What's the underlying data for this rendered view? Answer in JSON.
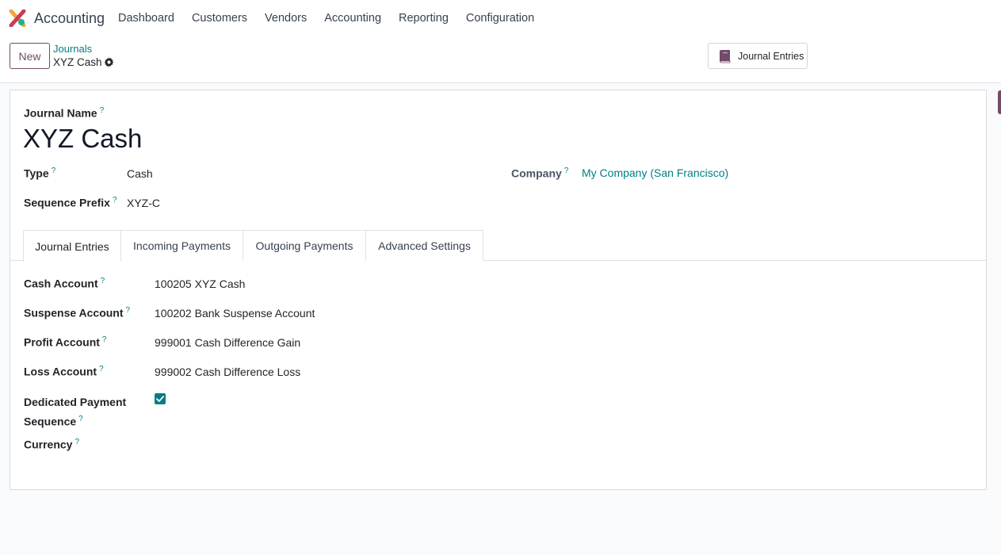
{
  "navbar": {
    "app_name": "Accounting",
    "menu": [
      "Dashboard",
      "Customers",
      "Vendors",
      "Accounting",
      "Reporting",
      "Configuration"
    ]
  },
  "control_panel": {
    "new_label": "New",
    "breadcrumb_parent": "Journals",
    "breadcrumb_current": "XYZ Cash",
    "smart_button_label": "Journal Entries"
  },
  "form": {
    "journal_name_label": "Journal Name",
    "journal_name": "XYZ Cash",
    "type_label": "Type",
    "type_value": "Cash",
    "sequence_prefix_label": "Sequence Prefix",
    "sequence_prefix_value": "XYZ-C",
    "company_label": "Company",
    "company_value": "My Company (San Francisco)",
    "help_mark": "?"
  },
  "tabs": [
    "Journal Entries",
    "Incoming Payments",
    "Outgoing Payments",
    "Advanced Settings"
  ],
  "journal_entries_tab": {
    "cash_account_label": "Cash Account",
    "cash_account_value": "100205 XYZ Cash",
    "suspense_account_label": "Suspense Account",
    "suspense_account_value": "100202 Bank Suspense Account",
    "profit_account_label": "Profit Account",
    "profit_account_value": "999001 Cash Difference Gain",
    "loss_account_label": "Loss Account",
    "loss_account_value": "999002 Cash Difference Loss",
    "dedicated_label_line1": "Dedicated Payment",
    "dedicated_label_line2": "Sequence",
    "dedicated_checked": true,
    "currency_label": "Currency"
  },
  "colors": {
    "brand": "#714b67",
    "link": "#017e84"
  }
}
